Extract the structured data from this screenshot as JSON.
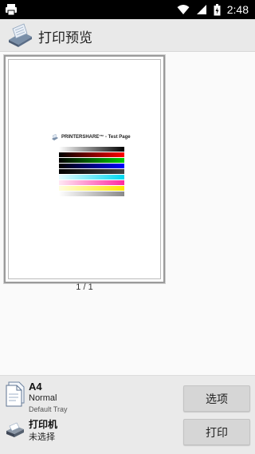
{
  "status_bar": {
    "time": "2:48",
    "icons": [
      "printer-icon",
      "wifi-icon",
      "cellular-signal-icon",
      "battery-charging-icon"
    ],
    "background": "#000000"
  },
  "app_bar": {
    "title": "打印预览",
    "icon": "printer-scanner-icon",
    "background": "#e9e9e9"
  },
  "preview": {
    "test_page_title": "PRINTERSHARE™ - Test Page",
    "page_count": "1 / 1"
  },
  "paper": {
    "size": "A4",
    "quality": "Normal",
    "tray": "Default Tray",
    "icon": "paper-document-icon"
  },
  "printer": {
    "label": "打印机",
    "status": "未选择",
    "icon": "printer-icon"
  },
  "buttons": {
    "options": "选项",
    "print": "打印"
  }
}
